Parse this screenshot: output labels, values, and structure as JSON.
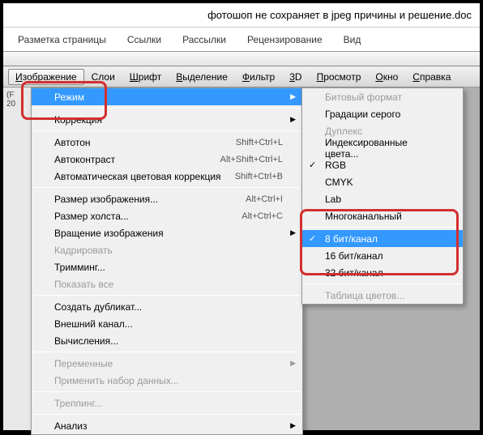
{
  "title": "фотошоп не сохраняет в jpeg причины и решение.doc",
  "tabs": [
    "Разметка страницы",
    "Ссылки",
    "Рассылки",
    "Рецензирование",
    "Вид"
  ],
  "menubar": [
    {
      "label": "Изображение",
      "u": "И",
      "active": true
    },
    {
      "label": "Слои",
      "u": "С"
    },
    {
      "label": "Шрифт",
      "u": "Ш"
    },
    {
      "label": "Выделение",
      "u": "В"
    },
    {
      "label": "Фильтр",
      "u": "Ф"
    },
    {
      "label": "3D",
      "u": "3"
    },
    {
      "label": "Просмотр",
      "u": "П"
    },
    {
      "label": "Окно",
      "u": "О"
    },
    {
      "label": "Справка",
      "u": "С"
    }
  ],
  "sidebar": {
    "t1": "(F",
    "t2": "20"
  },
  "menu1": [
    {
      "label": "Режим",
      "type": "sub",
      "hl": true
    },
    {
      "type": "sep"
    },
    {
      "label": "Коррекция",
      "type": "sub"
    },
    {
      "type": "sep"
    },
    {
      "label": "Автотон",
      "sc": "Shift+Ctrl+L"
    },
    {
      "label": "Автоконтраст",
      "sc": "Alt+Shift+Ctrl+L"
    },
    {
      "label": "Автоматическая цветовая коррекция",
      "sc": "Shift+Ctrl+B"
    },
    {
      "type": "sep"
    },
    {
      "label": "Размер изображения...",
      "sc": "Alt+Ctrl+I"
    },
    {
      "label": "Размер холста...",
      "sc": "Alt+Ctrl+C"
    },
    {
      "label": "Вращение изображения",
      "type": "sub"
    },
    {
      "label": "Кадрировать",
      "disabled": true
    },
    {
      "label": "Тримминг..."
    },
    {
      "label": "Показать все",
      "disabled": true
    },
    {
      "type": "sep"
    },
    {
      "label": "Создать дубликат..."
    },
    {
      "label": "Внешний канал..."
    },
    {
      "label": "Вычисления..."
    },
    {
      "type": "sep"
    },
    {
      "label": "Переменные",
      "type": "sub",
      "disabled": true
    },
    {
      "label": "Применить набор данных...",
      "disabled": true
    },
    {
      "type": "sep"
    },
    {
      "label": "Треппинг...",
      "disabled": true
    },
    {
      "type": "sep"
    },
    {
      "label": "Анализ",
      "type": "sub"
    }
  ],
  "menu2": [
    {
      "label": "Битовый формат",
      "disabled": true
    },
    {
      "label": "Градации серого"
    },
    {
      "label": "Дуплекс",
      "disabled": true
    },
    {
      "label": "Индексированные цвета..."
    },
    {
      "label": "RGB",
      "check": true
    },
    {
      "label": "CMYK"
    },
    {
      "label": "Lab"
    },
    {
      "label": "Многоканальный"
    },
    {
      "type": "sep"
    },
    {
      "label": "8 бит/канал",
      "check": true,
      "hl": true
    },
    {
      "label": "16 бит/канал"
    },
    {
      "label": "32 бит/канал"
    },
    {
      "type": "sep"
    },
    {
      "label": "Таблица цветов...",
      "disabled": true
    }
  ]
}
